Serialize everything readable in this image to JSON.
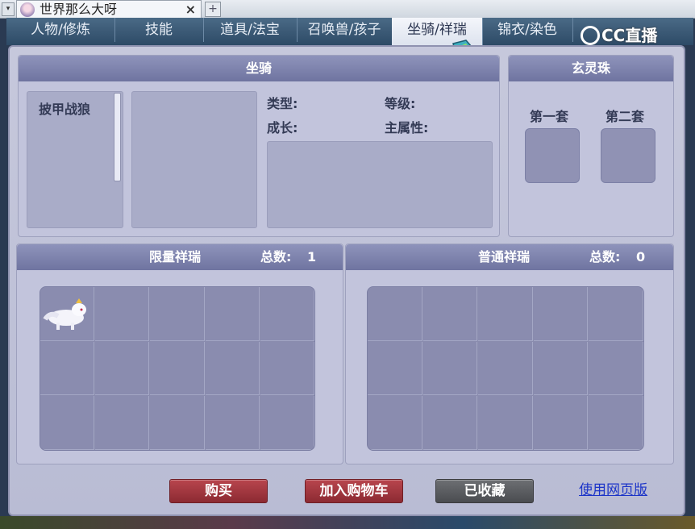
{
  "browser": {
    "tab_title": "世界那么大呀",
    "close_glyph": "×",
    "new_tab_glyph": "+",
    "dropdown_glyph": "▾"
  },
  "game_tabs": [
    {
      "label": "人物/修炼"
    },
    {
      "label": "技能"
    },
    {
      "label": "道具/法宝"
    },
    {
      "label": "召唤兽/孩子"
    },
    {
      "label": "坐骑/祥瑞",
      "active": true
    },
    {
      "label": "锦衣/染色"
    }
  ],
  "watermark": "CC直播",
  "mount_panel": {
    "title": "坐骑",
    "list": [
      "披甲战狼"
    ],
    "labels": {
      "type": "类型:",
      "level": "等级:",
      "growth": "成长:",
      "main_attr": "主属性:"
    }
  },
  "pearl_panel": {
    "title": "玄灵珠",
    "set1": "第一套",
    "set2": "第二套"
  },
  "limited": {
    "title": "限量祥瑞",
    "total_label": "总数:",
    "total": "1"
  },
  "normal": {
    "title": "普通祥瑞",
    "total_label": "总数:",
    "total": "0"
  },
  "buttons": {
    "buy": "购买",
    "add_cart": "加入购物车",
    "collected": "已收藏"
  },
  "link": "使用网页版",
  "colors": {
    "accent_red": "#8c2a32",
    "header": "#7a7fa8",
    "link": "#1c34c8"
  }
}
